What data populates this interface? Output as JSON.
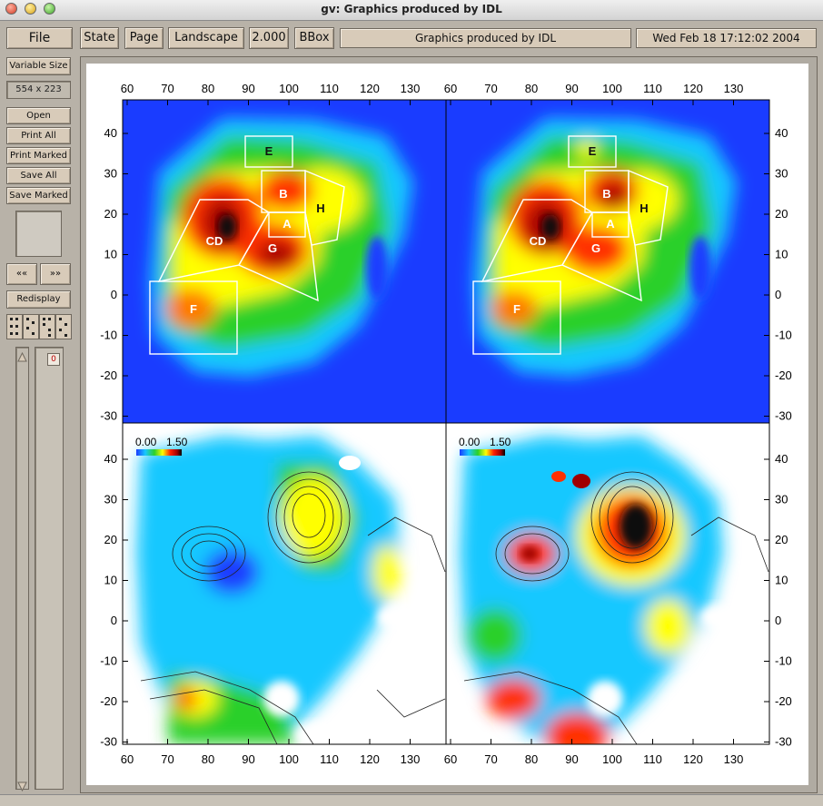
{
  "window": {
    "title": "gv: Graphics produced by IDL"
  },
  "toolbar": {
    "file": "File",
    "state": "State",
    "page": "Page",
    "orientation": "Landscape",
    "scale": "2.000",
    "bbox": "BBox",
    "doc_title": "Graphics produced by IDL",
    "date": "Wed Feb 18 17:12:02 2004"
  },
  "side": {
    "variable_size": "Variable Size",
    "size": "554 x 223",
    "open": "Open",
    "print_all": "Print All",
    "print_marked": "Print Marked",
    "save_all": "Save All",
    "save_marked": "Save Marked",
    "prev": "««",
    "next": "»»",
    "redisplay": "Redisplay",
    "page_number": "0"
  },
  "figure": {
    "x_ticks": [
      "60",
      "70",
      "80",
      "90",
      "100",
      "110",
      "120",
      "130"
    ],
    "top_y_ticks": [
      "40",
      "30",
      "20",
      "10",
      "0",
      "-10",
      "-20",
      "-30"
    ],
    "bottom_y_ticks": [
      "40",
      "30",
      "20",
      "10",
      "0",
      "-10",
      "-20",
      "-30"
    ],
    "colorbar": {
      "min": "0.00",
      "max": "1.50"
    },
    "regions": [
      "E",
      "B",
      "A",
      "H",
      "CD",
      "G",
      "F"
    ],
    "colors": {
      "background": "#1a47ff",
      "accent": "#e01010"
    }
  }
}
